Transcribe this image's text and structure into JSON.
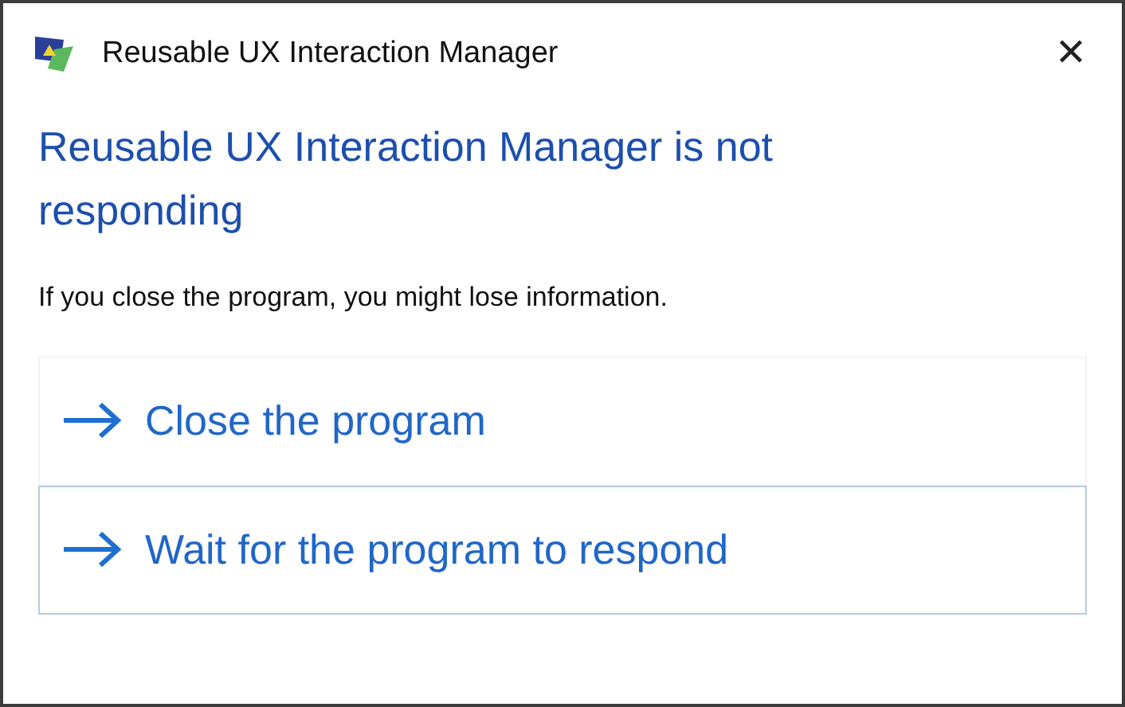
{
  "window": {
    "title": "Reusable UX Interaction Manager",
    "close": "✕"
  },
  "heading": "Reusable UX Interaction Manager is not responding",
  "message": "If you close the program, you might lose information.",
  "options": [
    {
      "label": "Close the program",
      "selected": false
    },
    {
      "label": "Wait for the program to respond",
      "selected": true
    }
  ]
}
